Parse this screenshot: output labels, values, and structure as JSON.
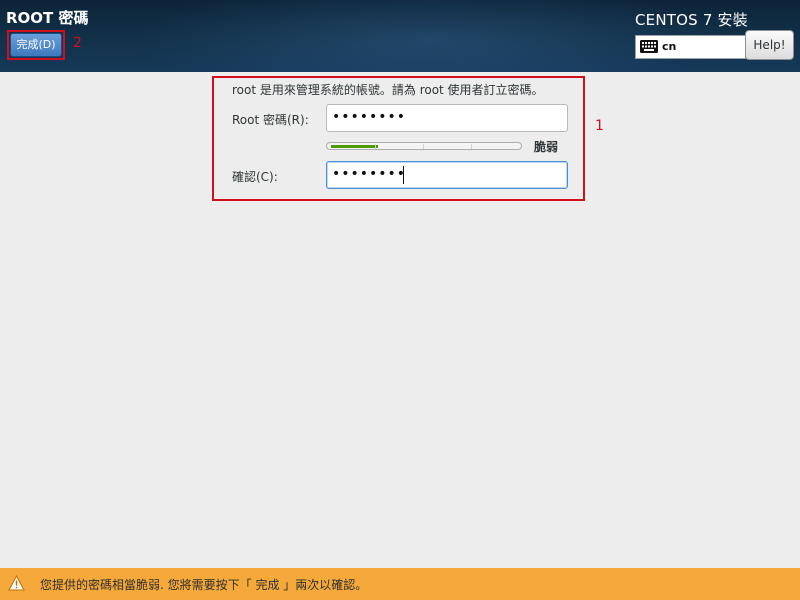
{
  "header": {
    "title": "ROOT 密碼",
    "done_button": "完成(D)",
    "product": "CENTOS 7 安裝",
    "keyboard_layout": "cn",
    "help_button": "Help!"
  },
  "annotations": {
    "marker_1": "1",
    "marker_2": "2"
  },
  "form": {
    "intro": "root 是用來管理系統的帳號。請為 root 使用者訂立密碼。",
    "root_password_label": "Root 密碼(R):",
    "root_password_value": "••••••••",
    "strength_label": "脆弱",
    "strength_level": 0.25,
    "confirm_label": "確認(C):",
    "confirm_value": "••••••••"
  },
  "warning_bar": {
    "icon": "warning-triangle-icon",
    "message": "您提供的密碼相當脆弱. 您將需要按下「 完成 」兩次以確認。"
  },
  "colors": {
    "header_bg": "#12314a",
    "done_button": "#3e78bd",
    "annotation_red": "#d0101e",
    "meter_fill": "#4e9a06",
    "warning_bg": "#f5a93a"
  }
}
